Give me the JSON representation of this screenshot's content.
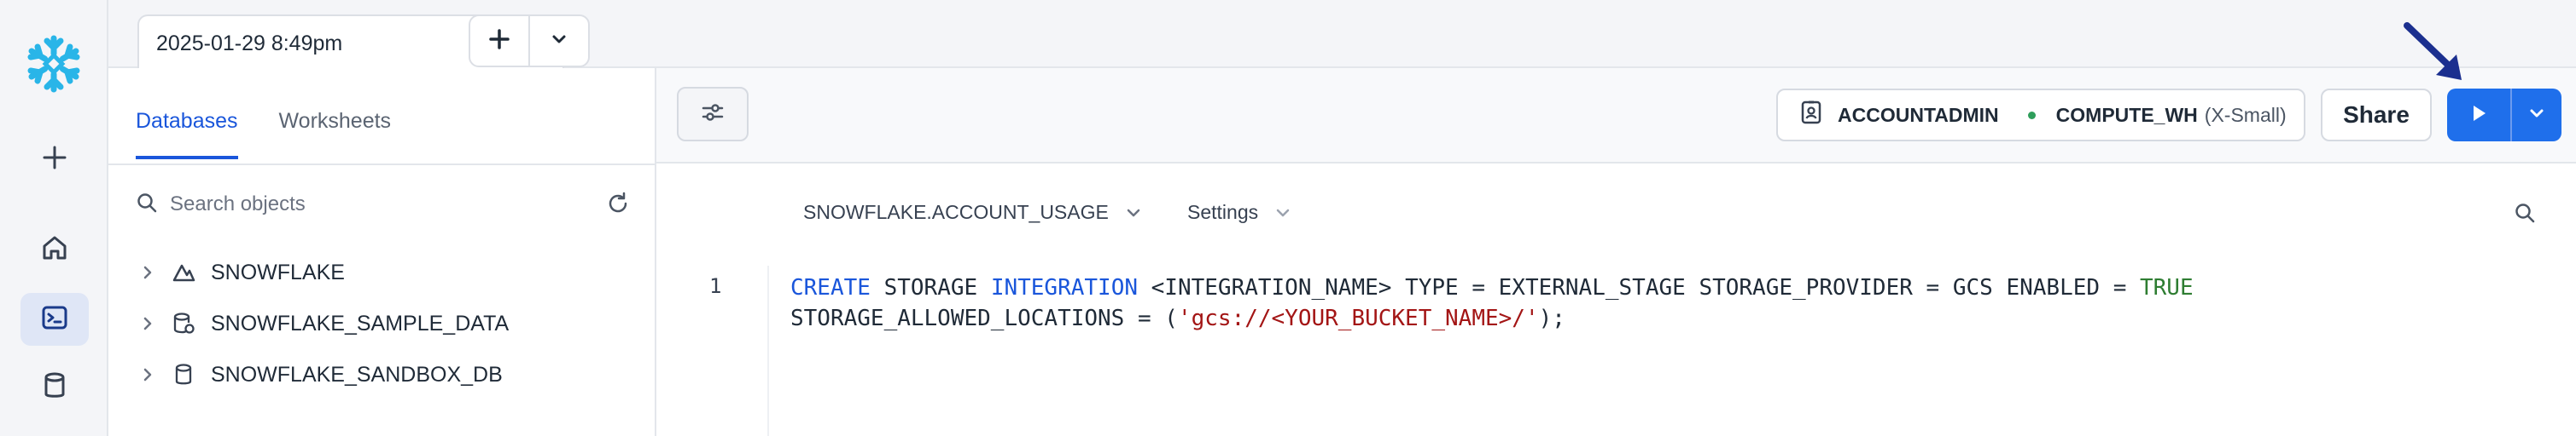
{
  "colors": {
    "accent": "#1f6feb",
    "link": "#1a56db",
    "logo": "#29b5e8",
    "keyword": "#1a56db",
    "string": "#a31515",
    "boolean": "#2e7d32",
    "warehouse_status": "#2e9e5b"
  },
  "rail": {
    "items": [
      {
        "icon": "plus-icon"
      },
      {
        "icon": "home-icon"
      },
      {
        "icon": "worksheets-icon",
        "active": true
      },
      {
        "icon": "database-icon"
      }
    ]
  },
  "tabs": {
    "worksheet_title": "2025-01-29 8:49pm"
  },
  "browser": {
    "tabs": [
      {
        "label": "Databases",
        "active": true
      },
      {
        "label": "Worksheets",
        "active": false
      }
    ],
    "search_placeholder": "Search objects",
    "tree": [
      {
        "label": "SNOWFLAKE",
        "icon": "shared-database-icon"
      },
      {
        "label": "SNOWFLAKE_SAMPLE_DATA",
        "icon": "sample-database-icon"
      },
      {
        "label": "SNOWFLAKE_SANDBOX_DB",
        "icon": "database-icon"
      }
    ]
  },
  "toolbar": {
    "role": "ACCOUNTADMIN",
    "warehouse": "COMPUTE_WH",
    "warehouse_size": "(X-Small)",
    "share_label": "Share"
  },
  "context": {
    "database_schema": "SNOWFLAKE.ACCOUNT_USAGE",
    "settings_label": "Settings"
  },
  "editor": {
    "line_numbers": [
      "1"
    ],
    "line1": {
      "t1": "CREATE",
      "t2": " STORAGE ",
      "t3": "INTEGRATION",
      "t4": " <INTEGRATION_NAME> TYPE = EXTERNAL_STAGE STORAGE_PROVIDER = GCS ENABLED = ",
      "t5": "TRUE"
    },
    "line2": {
      "t1": "STORAGE_ALLOWED_LOCATIONS = (",
      "t2": "'gcs://<YOUR_BUCKET_NAME>/'",
      "t3": ");"
    }
  }
}
